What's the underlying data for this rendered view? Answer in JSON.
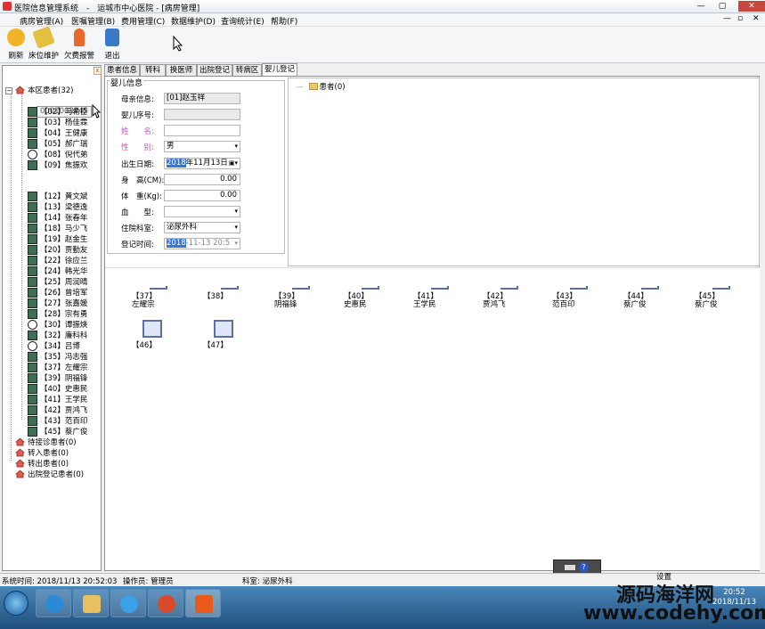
{
  "window": {
    "app_name": "医院信息管理系统",
    "title": "运城市中心医院 - [病房管理]",
    "min": "—",
    "restore": "▢",
    "close": "✕"
  },
  "menu": [
    {
      "label": "病房管理(A)"
    },
    {
      "label": "医嘱管理(B)"
    },
    {
      "label": "费用管理(C)"
    },
    {
      "label": "数据维护(D)"
    },
    {
      "label": "查询统计(E)"
    },
    {
      "label": "帮助(F)"
    }
  ],
  "mdi_controls": {
    "min": "—",
    "restore": "▫",
    "close": "✕"
  },
  "toolbar": [
    {
      "label": "刷新",
      "icon": "refresh-icon",
      "color": "#f0b428"
    },
    {
      "label": "床位维护",
      "icon": "bed-edit-icon",
      "color": "#e4c040"
    },
    {
      "label": "欠费报警",
      "icon": "alarm-icon",
      "color": "#e86a2a"
    },
    {
      "label": "退出",
      "icon": "exit-icon",
      "color": "#3a78c8"
    }
  ],
  "left_tree": {
    "close_glyph": "x",
    "root": "本区患者(32)",
    "tooltip": "0001003245",
    "patients_top": [
      {
        "label": "【02】马希臣"
      },
      {
        "label": "【03】杨佳霖"
      },
      {
        "label": "【04】王健康"
      },
      {
        "label": "【05】郝广瑞"
      },
      {
        "label": "【08】倪代弟"
      },
      {
        "label": "【09】焦振欢"
      }
    ],
    "patients_bottom": [
      {
        "label": "【12】黄文斌"
      },
      {
        "label": "【13】梁德逸"
      },
      {
        "label": "【14】张春年"
      },
      {
        "label": "【18】马少飞"
      },
      {
        "label": "【19】赵金生"
      },
      {
        "label": "【20】贾勤友"
      },
      {
        "label": "【22】徐应兰"
      },
      {
        "label": "【24】韩光华"
      },
      {
        "label": "【25】周润晴"
      },
      {
        "label": "【26】曾培军"
      },
      {
        "label": "【27】张嘉媛"
      },
      {
        "label": "【28】宗有勇"
      },
      {
        "label": "【30】谭振焕"
      },
      {
        "label": "【32】廉科科"
      },
      {
        "label": "【34】吕博"
      },
      {
        "label": "【35】冯志强"
      },
      {
        "label": "【37】左耀宗"
      },
      {
        "label": "【39】阴福锋"
      },
      {
        "label": "【40】史惠民"
      },
      {
        "label": "【41】王学民"
      },
      {
        "label": "【42】贾鸿飞"
      },
      {
        "label": "【43】范百印"
      },
      {
        "label": "【45】蔡广俊"
      }
    ],
    "other_nodes": [
      {
        "label": "待接诊患者(0)"
      },
      {
        "label": "转入患者(0)"
      },
      {
        "label": "转出患者(0)"
      },
      {
        "label": "出院登记患者(0)"
      }
    ]
  },
  "tabs": [
    {
      "label": "患者信息"
    },
    {
      "label": "转科"
    },
    {
      "label": "换医师"
    },
    {
      "label": "出院登记"
    },
    {
      "label": "转病区"
    },
    {
      "label": "婴儿登记"
    }
  ],
  "baby_form": {
    "legend": "婴儿信息",
    "mother_label": "母亲信息:",
    "mother_value": "[01]赵玉祥",
    "seq_label": "婴儿序号:",
    "seq_value": "",
    "name_label": "姓　　名:",
    "name_value": "",
    "sex_label": "性　　别:",
    "sex_value": "男",
    "birth_label": "出生日期:",
    "birth_value_hl": "2018",
    "birth_value_rest": "年11月13日",
    "height_label": "身　高(CM):",
    "height_value": "0.00",
    "weight_label": "体　重(Kg):",
    "weight_value": "0.00",
    "blood_label": "血　　型:",
    "blood_value": "",
    "dept_label": "住院科室:",
    "dept_value": "泌尿外科",
    "reg_label": "登记时间:",
    "reg_value_hl": "2018",
    "reg_value_rest": "-11-13 20:5",
    "dropdown_glyph": "▾"
  },
  "right_tree": {
    "root": "患者(0)"
  },
  "beds": [
    {
      "num": "【37】",
      "name": "左耀宗"
    },
    {
      "num": "【38】",
      "name": ""
    },
    {
      "num": "【39】",
      "name": "阴福锋"
    },
    {
      "num": "【40】",
      "name": "史惠民"
    },
    {
      "num": "【41】",
      "name": "王学民"
    },
    {
      "num": "【42】",
      "name": "贾鸿飞"
    },
    {
      "num": "【43】",
      "name": "范百印"
    },
    {
      "num": "【44】",
      "name": "蔡广俊"
    },
    {
      "num": "【45】",
      "name": "蔡广俊"
    }
  ],
  "empty_beds": [
    {
      "num": "【46】"
    },
    {
      "num": "【47】"
    }
  ],
  "widget": {
    "help": "?"
  },
  "status": {
    "time": "系统时间: 2018/11/13 20:52:03",
    "operator": "操作员: 管理员",
    "dept": "科室: 泌尿外科",
    "settings": "设置"
  },
  "taskbar": {
    "apps": [
      {
        "icon": "ie-icon",
        "color": "#2a8ad8"
      },
      {
        "icon": "folder-icon",
        "color": "#e8c060"
      },
      {
        "icon": "ie-alt-icon",
        "color": "#3aa0e8"
      },
      {
        "icon": "app-icon",
        "color": "#d84a2a"
      },
      {
        "icon": "windows-app-icon",
        "color": "#e85a1a"
      }
    ],
    "clock_time": "20:52",
    "clock_date": "2018/11/13"
  },
  "watermark": {
    "line1": "源码海洋网",
    "line2": "www.codehy.com"
  }
}
